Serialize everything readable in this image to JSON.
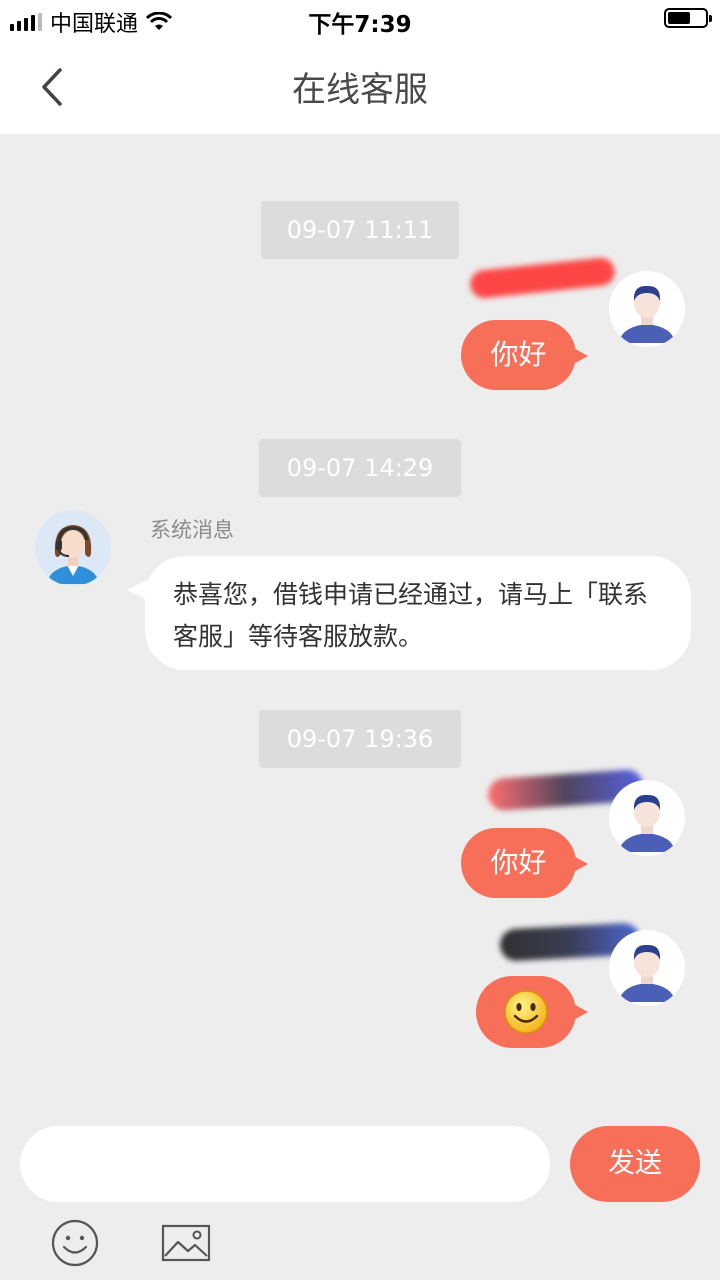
{
  "status_bar": {
    "carrier": "中国联通",
    "time": "下午7:39"
  },
  "header": {
    "title": "在线客服"
  },
  "messages": {
    "ts1": "09-07 11:11",
    "msg1": "你好",
    "ts2": "09-07 14:29",
    "system_sender": "系统消息",
    "system_text": "恭喜您，借钱申请已经通过，请马上「联系客服」等待客服放款。",
    "ts3": "09-07 19:36",
    "msg2": "你好",
    "msg3_icon": "smile-emoji-icon"
  },
  "composer": {
    "input_value": "",
    "send_label": "发送"
  },
  "toolbar": {
    "emoji_icon": "smiley-icon",
    "image_icon": "image-icon"
  },
  "colors": {
    "accent": "#f76e59",
    "chat_bg": "#ededed",
    "timestamp_bg": "#dcdcdc",
    "avatar_blue": "#4a5fb5"
  }
}
